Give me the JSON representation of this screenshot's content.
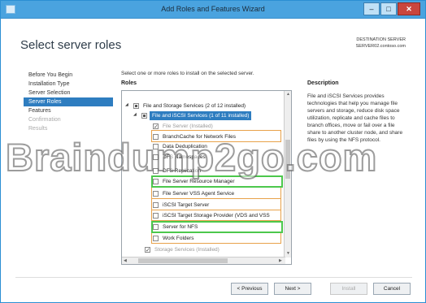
{
  "window": {
    "title": "Add Roles and Features Wizard"
  },
  "page_title": "Select server roles",
  "destination": {
    "label": "DESTINATION SERVER",
    "server": "SERVER02.contoso.com"
  },
  "nav": [
    {
      "label": "Before You Begin"
    },
    {
      "label": "Installation Type"
    },
    {
      "label": "Server Selection"
    },
    {
      "label": "Server Roles"
    },
    {
      "label": "Features"
    },
    {
      "label": "Confirmation"
    },
    {
      "label": "Results"
    }
  ],
  "instruction": "Select one or more roles to install on the selected server.",
  "roles_label": "Roles",
  "description_label": "Description",
  "description": "File and iSCSI Services provides technologies that help you manage file servers and storage, reduce disk space utilization, replicate and cache files to branch offices, move or fail over a file share to another cluster node, and share files by using the NFS protocol.",
  "roles": [
    {
      "label": "File and Storage Services (2 of 12 installed)"
    },
    {
      "label": "File and iSCSI Services (1 of 11 installed)"
    },
    {
      "label": "File Server (Installed)"
    },
    {
      "label": "BranchCache for Network Files"
    },
    {
      "label": "Data Deduplication"
    },
    {
      "label": "DFS Namespaces"
    },
    {
      "label": "DFS Replication"
    },
    {
      "label": "File Server Resource Manager"
    },
    {
      "label": "File Server VSS Agent Service"
    },
    {
      "label": "iSCSI Target Server"
    },
    {
      "label": "iSCSI Target Storage Provider (VDS and VSS"
    },
    {
      "label": "Server for NFS"
    },
    {
      "label": "Work Folders"
    },
    {
      "label": "Storage Services (Installed)"
    }
  ],
  "watermark": "Braindump2go.com",
  "buttons": {
    "previous": "< Previous",
    "next": "Next >",
    "install": "Install",
    "cancel": "Cancel"
  }
}
